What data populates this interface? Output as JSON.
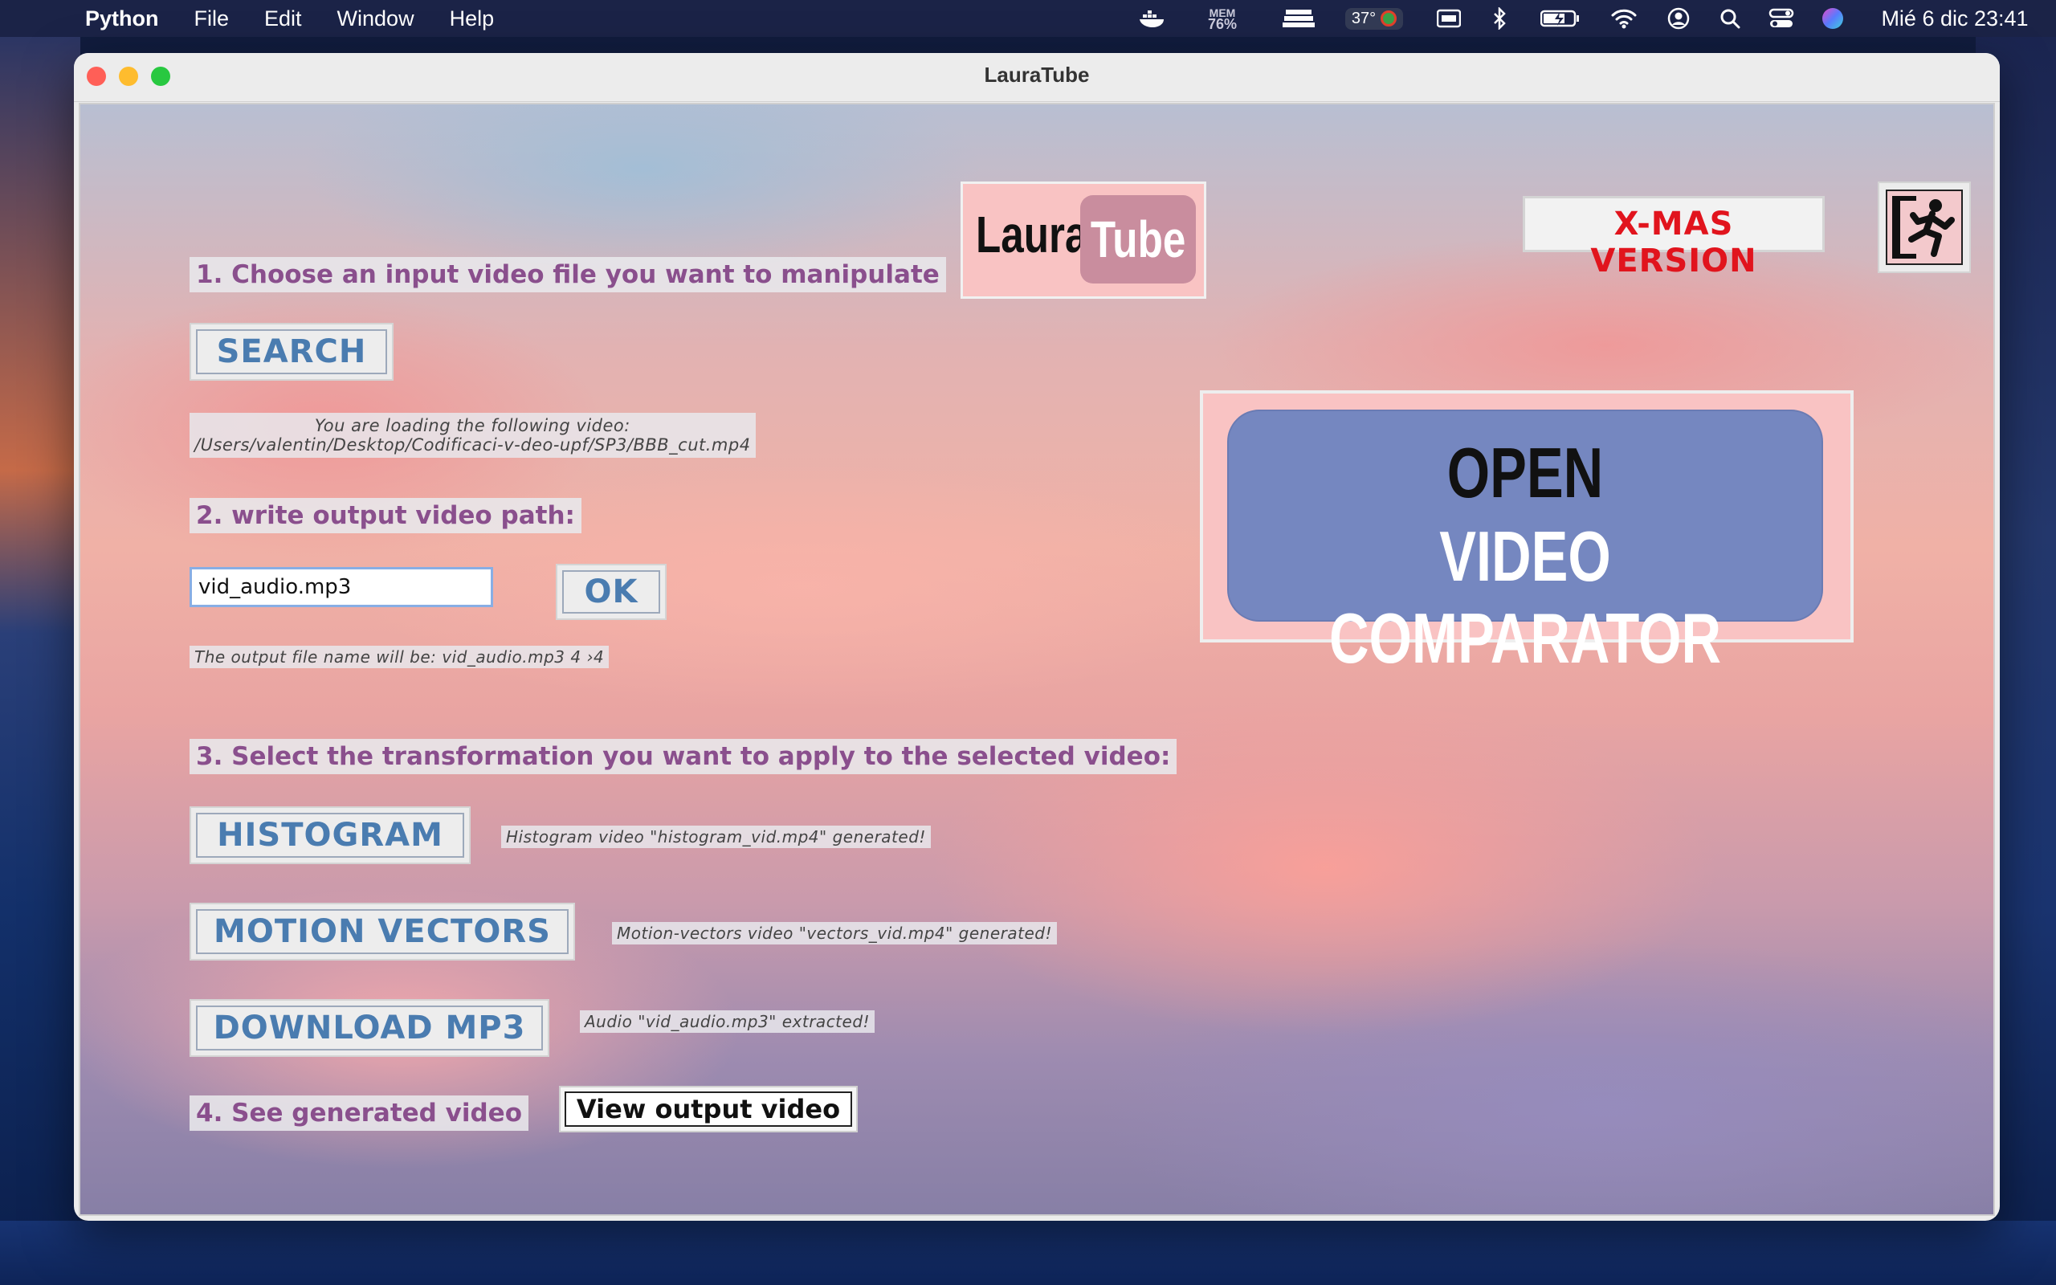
{
  "menubar": {
    "apple_glyph": "",
    "app_name": "Python",
    "menus": [
      "File",
      "Edit",
      "Window",
      "Help"
    ],
    "mem_label": "MEM",
    "mem_value": "76%",
    "temperature": "37°",
    "clock": "Mié 6 dic  23:41"
  },
  "window": {
    "title": "LauraTube"
  },
  "logo": {
    "part1": "Laura",
    "part2": "Tube"
  },
  "xmas_label": "X-MAS VERSION",
  "steps": {
    "step1": "1. Choose an input video file you want to manipulate",
    "search_button": "SEARCH",
    "loading_line1": "You are loading the following video:",
    "loading_line2": "/Users/valentin/Desktop/Codificaci-v-deo-upf/SP3/BBB_cut.mp4",
    "step2": "2. write output video path:",
    "output_input_value": "vid_audio.mp3",
    "ok_button": "OK",
    "output_info": "The output file name will be: vid_audio.mp3 4 ›4",
    "step3": "3. Select the transformation you want to apply to the selected video:",
    "histogram_button": "HISTOGRAM",
    "histogram_status": "Histogram video \"histogram_vid.mp4\" generated!",
    "motion_button": "MOTION VECTORS",
    "motion_status": "Motion-vectors video \"vectors_vid.mp4\" generated!",
    "mp3_button": "DOWNLOAD MP3",
    "mp3_status": "Audio \"vid_audio.mp3\" extracted!",
    "step4": "4. See generated video",
    "view_button": "View output video"
  },
  "comparator": {
    "line1": "OPEN",
    "line2": "VIDEO COMPARATOR"
  },
  "colors": {
    "label_text": "#8a4f8d",
    "button_text": "#4a7cb0",
    "xmas_text": "#e1141d",
    "comparator_bg": "#7587c0",
    "logo_bg": "#f9c3c3"
  },
  "icons": [
    "apple-icon",
    "docker-icon",
    "memory-icon",
    "stack-icon",
    "temperature-icon",
    "display-icon",
    "bluetooth-icon",
    "battery-icon",
    "wifi-icon",
    "user-icon",
    "search-icon",
    "control-center-icon",
    "siri-icon",
    "exit-icon"
  ]
}
